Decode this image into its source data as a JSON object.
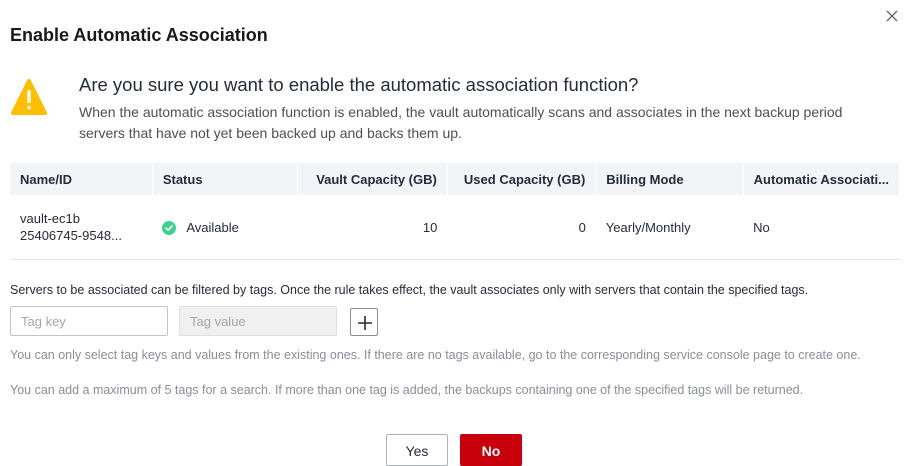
{
  "dialog": {
    "title": "Enable Automatic Association",
    "question": "Are you sure you want to enable the automatic association function?",
    "description": "When the automatic association function is enabled, the vault automatically scans and associates in the next backup period servers that have not yet been backed up and backs them up."
  },
  "table": {
    "headers": [
      "Name/ID",
      "Status",
      "Vault Capacity (GB)",
      "Used Capacity (GB)",
      "Billing Mode",
      "Automatic Associati..."
    ],
    "rows": [
      {
        "name": "vault-ec1b",
        "id": "25406745-9548...",
        "status": "Available",
        "vault_capacity": "10",
        "used_capacity": "0",
        "billing_mode": "Yearly/Monthly",
        "auto_association": "No"
      }
    ]
  },
  "filter": {
    "text": "Servers to be associated can be filtered by tags. Once the rule takes effect, the vault associates only with servers that contain the specified tags.",
    "tag_key_placeholder": "Tag key",
    "tag_value_placeholder": "Tag value",
    "hint1": "You can only select tag keys and values from the existing ones. If there are no tags available, go to the corresponding service console page to create one.",
    "hint2": "You can add a maximum of 5 tags for a search. If more than one tag is added, the backups containing one of the specified tags will be returned."
  },
  "buttons": {
    "yes": "Yes",
    "no": "No"
  },
  "colors": {
    "primary": "#c7000b",
    "warning": "#ffbf00",
    "available": "#3fcf8e"
  },
  "icons": {
    "close": "close-icon",
    "warning": "warning-icon",
    "status": "check-circle-icon",
    "add": "plus-icon"
  }
}
